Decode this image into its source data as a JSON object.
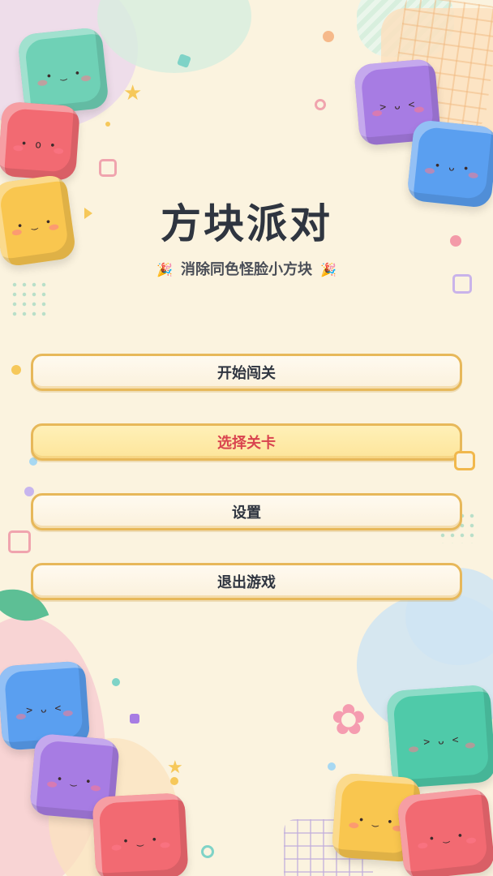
{
  "game": {
    "title": "方块派对",
    "subtitle": "消除同色怪脸小方块",
    "subtitle_icon": "party-popper-icon"
  },
  "menu": {
    "items": [
      {
        "label": "开始闯关",
        "selected": false
      },
      {
        "label": "选择关卡",
        "selected": true
      },
      {
        "label": "设置",
        "selected": false
      },
      {
        "label": "退出游戏",
        "selected": false
      }
    ]
  },
  "colors": {
    "background": "#fbf3df",
    "button_border": "#e7b85a",
    "selected_text": "#d9434f",
    "title_text": "#2f3540",
    "cube_colors": [
      "#6fd1b6",
      "#f26a72",
      "#f9c64f",
      "#a77ce3",
      "#5a9ff0",
      "#4fcaa9"
    ]
  },
  "cube_faces": {
    "happy": "• ᴗ •",
    "wink": "> ᴗ <",
    "surprised": "• o •",
    "calm": "• ‿ •"
  }
}
